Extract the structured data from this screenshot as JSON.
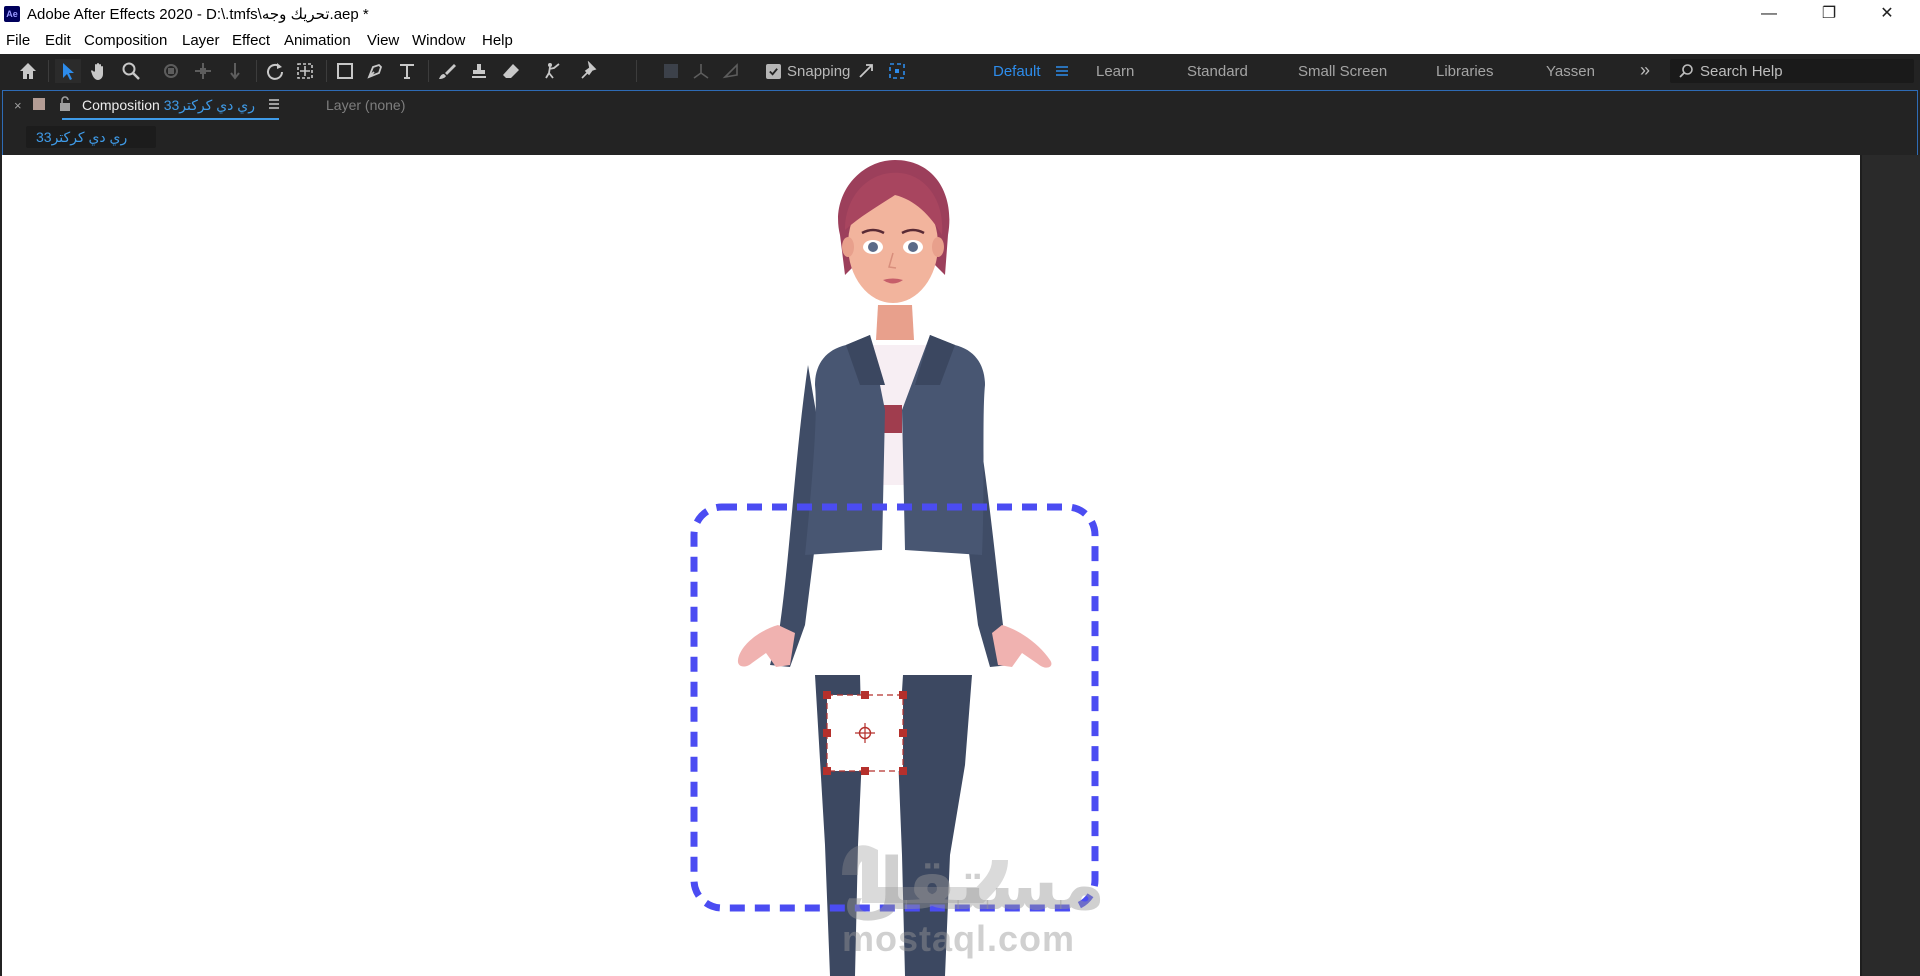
{
  "window": {
    "app_icon_text": "Ae",
    "title": "Adobe After Effects 2020 - D:\\.tmfs\\تحريك وجه.aep *",
    "controls": {
      "minimize": "—",
      "maximize": "❐",
      "close": "✕"
    }
  },
  "menu": {
    "items": [
      "File",
      "Edit",
      "Composition",
      "Layer",
      "Effect",
      "Animation",
      "View",
      "Window",
      "Help"
    ]
  },
  "toolbar": {
    "tools": [
      "home-icon",
      "selection-tool-icon",
      "hand-tool-icon",
      "zoom-tool-icon",
      "orbit-camera-icon",
      "pan-camera-icon",
      "dolly-camera-icon",
      "rotation-tool-icon",
      "pan-behind-icon",
      "rectangle-tool-icon",
      "pen-tool-icon",
      "type-tool-icon",
      "brush-tool-icon",
      "clone-stamp-icon",
      "eraser-tool-icon",
      "roto-brush-icon",
      "puppet-pin-icon"
    ],
    "snapping_label": "Snapping",
    "snapping_checked": true
  },
  "workspaces": {
    "items": [
      "Default",
      "Learn",
      "Standard",
      "Small Screen",
      "Libraries",
      "Yassen"
    ],
    "active": "Default",
    "more": "»"
  },
  "search": {
    "placeholder": "Search Help"
  },
  "panel": {
    "close_symbol": "×",
    "tab_prefix": "Composition",
    "comp_name": "ري دي كركتر33",
    "layer_tab": "Layer  (none)",
    "breadcrumb": "ري دي كركتر33"
  },
  "watermark": {
    "arabic": "مستقل",
    "latin": "mostaql.com"
  },
  "colors": {
    "accent_blue": "#2d8ceb",
    "panel_bg": "#232323",
    "selection_box": "#4b4cf2",
    "anchor_handles": "#b5302c",
    "jacket": "#485672",
    "shirt": "#f7eef3",
    "skin": "#f2b49d",
    "hair": "#9c3f5b"
  }
}
